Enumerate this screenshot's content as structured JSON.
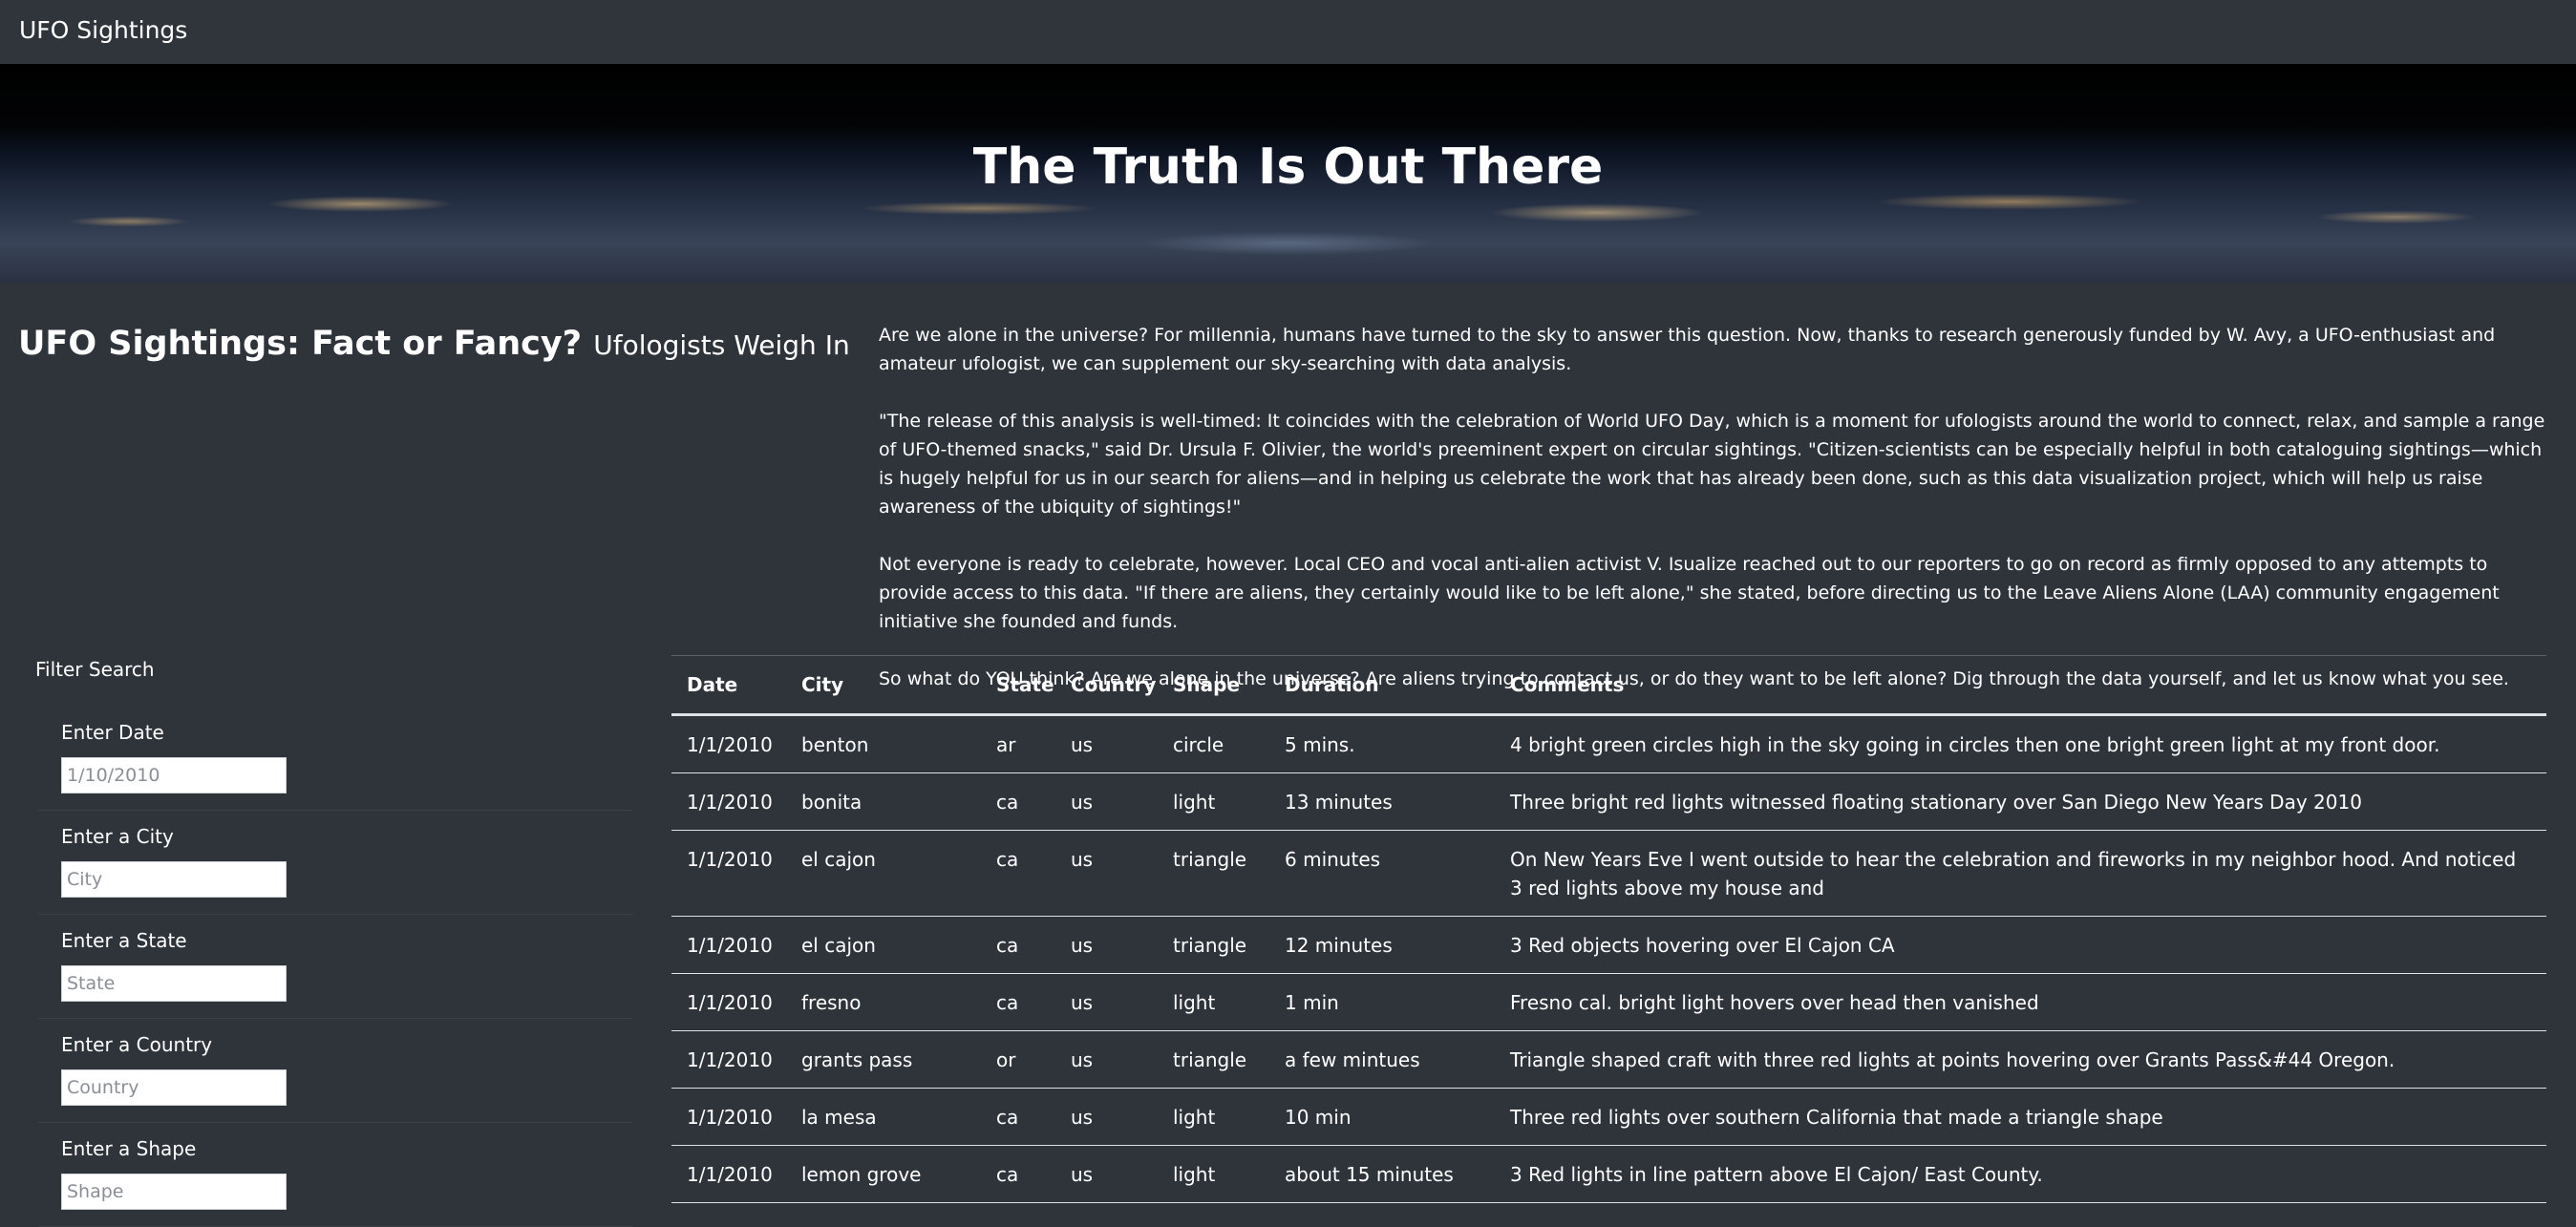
{
  "navbar": {
    "brand": "UFO Sightings"
  },
  "hero": {
    "title": "The Truth Is Out There"
  },
  "heading": {
    "main": "UFO Sightings: Fact or Fancy?",
    "sub": "Ufologists Weigh In"
  },
  "article": {
    "paragraphs": [
      "Are we alone in the universe? For millennia, humans have turned to the sky to answer this question. Now, thanks to research generously funded by W. Avy, a UFO-enthusiast and amateur ufologist, we can supplement our sky-searching with data analysis.",
      "\"The release of this analysis is well-timed: It coincides with the celebration of World UFO Day, which is a moment for ufologists around the world to connect, relax, and sample a range of UFO-themed snacks,\" said Dr. Ursula F. Olivier, the world's preeminent expert on circular sightings. \"Citizen-scientists can be especially helpful in both cataloguing sightings—which is hugely helpful for us in our search for aliens—and in helping us celebrate the work that has already been done, such as this data visualization project, which will help us raise awareness of the ubiquity of sightings!\"",
      "Not everyone is ready to celebrate, however. Local CEO and vocal anti-alien activist V. Isualize reached out to our reporters to go on record as firmly opposed to any attempts to provide access to this data. \"If there are aliens, they certainly would like to be left alone,\" she stated, before directing us to the Leave Aliens Alone (LAA) community engagement initiative she founded and funds.",
      "So what do YOU think? Are we alone in the universe? Are aliens trying to contact us, or do they want to be left alone? Dig through the data yourself, and let us know what you see."
    ]
  },
  "filters": {
    "title": "Filter Search",
    "items": [
      {
        "label": "Enter Date",
        "placeholder": "1/10/2010"
      },
      {
        "label": "Enter a City",
        "placeholder": "City"
      },
      {
        "label": "Enter a State",
        "placeholder": "State"
      },
      {
        "label": "Enter a Country",
        "placeholder": "Country"
      },
      {
        "label": "Enter a Shape",
        "placeholder": "Shape"
      }
    ]
  },
  "table": {
    "headers": [
      "Date",
      "City",
      "State",
      "Country",
      "Shape",
      "Duration",
      "Comments"
    ],
    "rows": [
      [
        "1/1/2010",
        "benton",
        "ar",
        "us",
        "circle",
        "5 mins.",
        "4 bright green circles high in the sky going in circles then one bright green light at my front door."
      ],
      [
        "1/1/2010",
        "bonita",
        "ca",
        "us",
        "light",
        "13 minutes",
        "Three bright red lights witnessed floating stationary over San Diego New Years Day 2010"
      ],
      [
        "1/1/2010",
        "el cajon",
        "ca",
        "us",
        "triangle",
        "6 minutes",
        "On New Years Eve I went outside to hear the celebration and fireworks in my neighbor hood. And noticed 3 red lights above my house and"
      ],
      [
        "1/1/2010",
        "el cajon",
        "ca",
        "us",
        "triangle",
        "12 minutes",
        "3 Red objects hovering over El Cajon CA"
      ],
      [
        "1/1/2010",
        "fresno",
        "ca",
        "us",
        "light",
        "1 min",
        "Fresno cal. bright light hovers over head then vanished"
      ],
      [
        "1/1/2010",
        "grants pass",
        "or",
        "us",
        "triangle",
        "a few mintues",
        "Triangle shaped craft with three red lights at points hovering over Grants Pass&#44 Oregon."
      ],
      [
        "1/1/2010",
        "la mesa",
        "ca",
        "us",
        "light",
        "10 min",
        "Three red lights over southern California that made a triangle shape"
      ],
      [
        "1/1/2010",
        "lemon grove",
        "ca",
        "us",
        "light",
        "about 15 minutes",
        "3 Red lights in line pattern above El Cajon/ East County."
      ]
    ]
  }
}
